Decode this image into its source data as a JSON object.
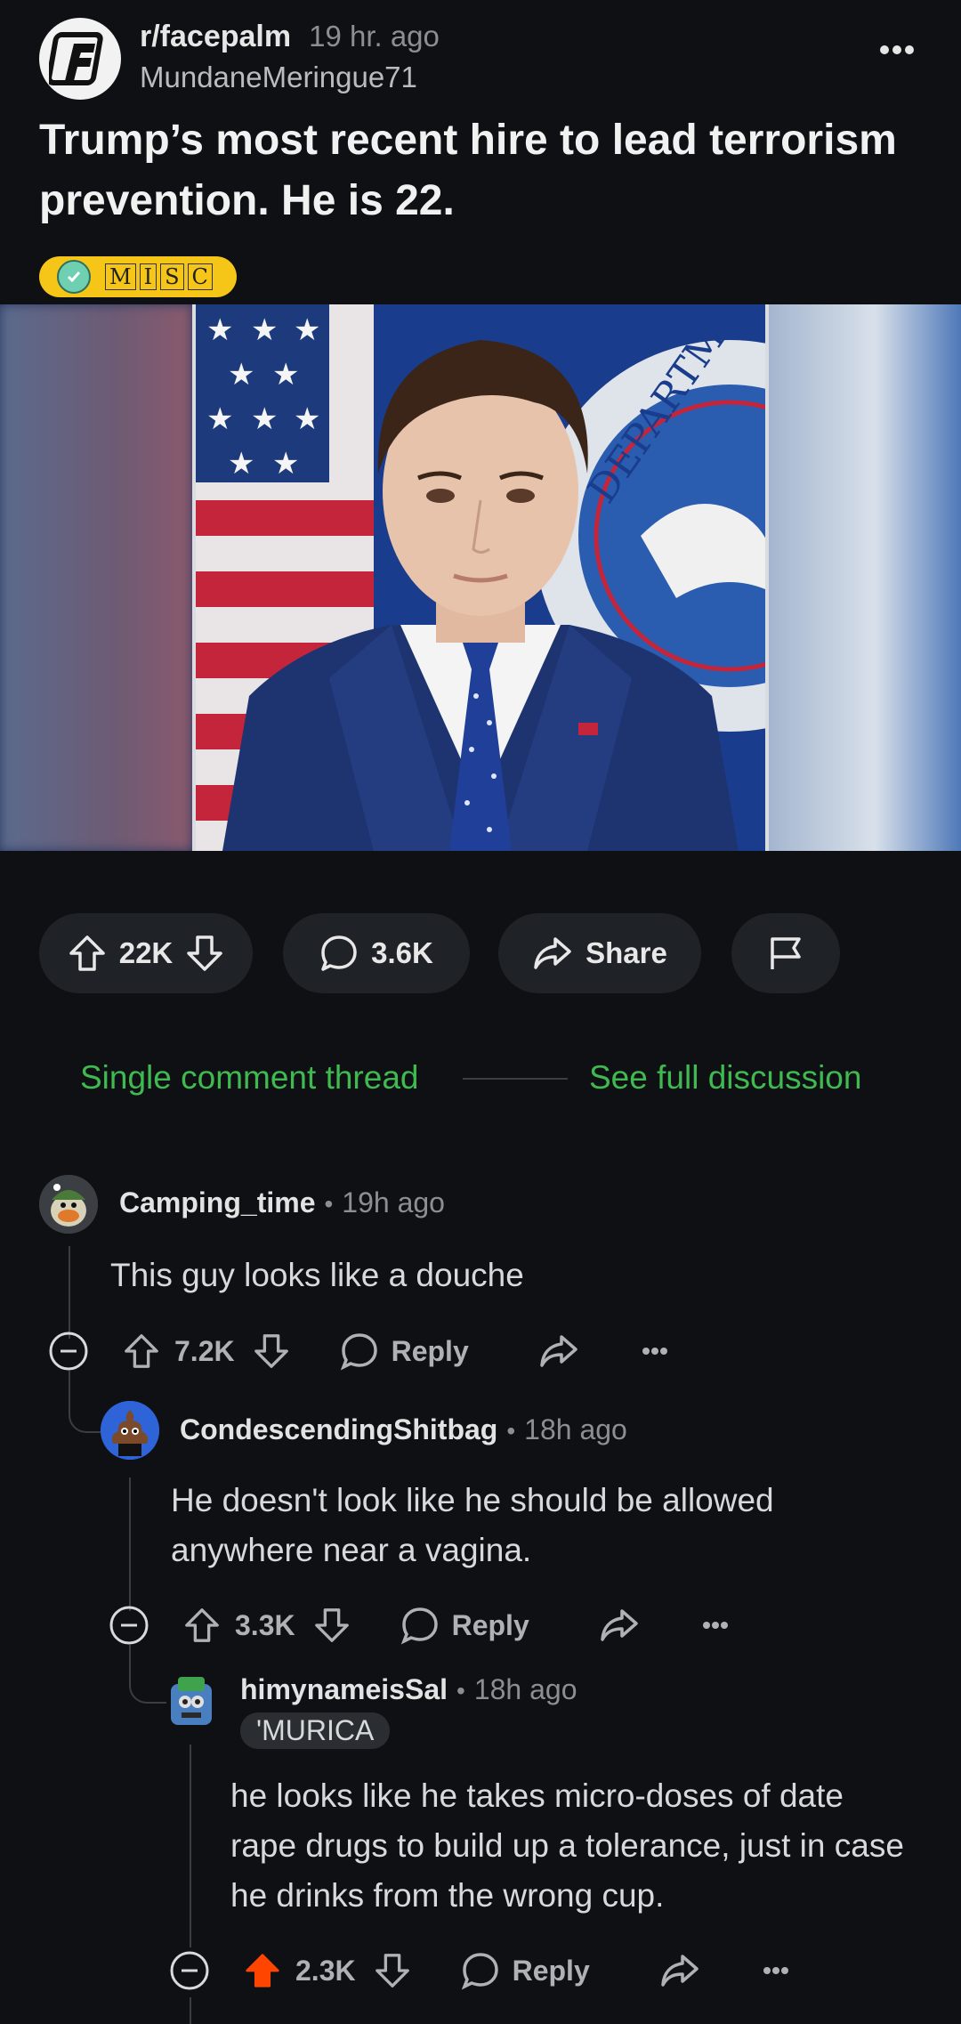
{
  "post": {
    "subreddit": "r/facepalm",
    "time_ago": "19 hr. ago",
    "author": "MundaneMeringue71",
    "title": "Trump’s most recent hire to lead terrorism prevention. He is 22.",
    "flair_letters": [
      "M",
      "I",
      "S",
      "C"
    ],
    "image_seal_text": "DEPARTME"
  },
  "actions": {
    "upvotes": "22K",
    "comments": "3.6K",
    "share_label": "Share"
  },
  "thread_nav": {
    "single_thread": "Single comment thread",
    "full_discussion": "See full discussion"
  },
  "comments": [
    {
      "user": "Camping_time",
      "time": "19h ago",
      "body": "This guy looks like a douche",
      "votes": "7.2K",
      "reply_label": "Reply"
    },
    {
      "user": "CondescendingShitbag",
      "time": "18h ago",
      "body": "He doesn't look like he should be allowed anywhere near a vagina.",
      "votes": "3.3K",
      "reply_label": "Reply"
    },
    {
      "user": "himynameisSal",
      "time": "18h ago",
      "flair": "'MURICA",
      "body": "he looks like he takes micro-doses of date rape drugs to build up a tolerance, just in case he drinks from the wrong cup.",
      "votes": "2.3K",
      "reply_label": "Reply"
    }
  ],
  "colors": {
    "background": "#0e1014",
    "accent_green": "#3fb950",
    "upvote_active": "#ff4500",
    "flair_bg": "#f5c518"
  }
}
